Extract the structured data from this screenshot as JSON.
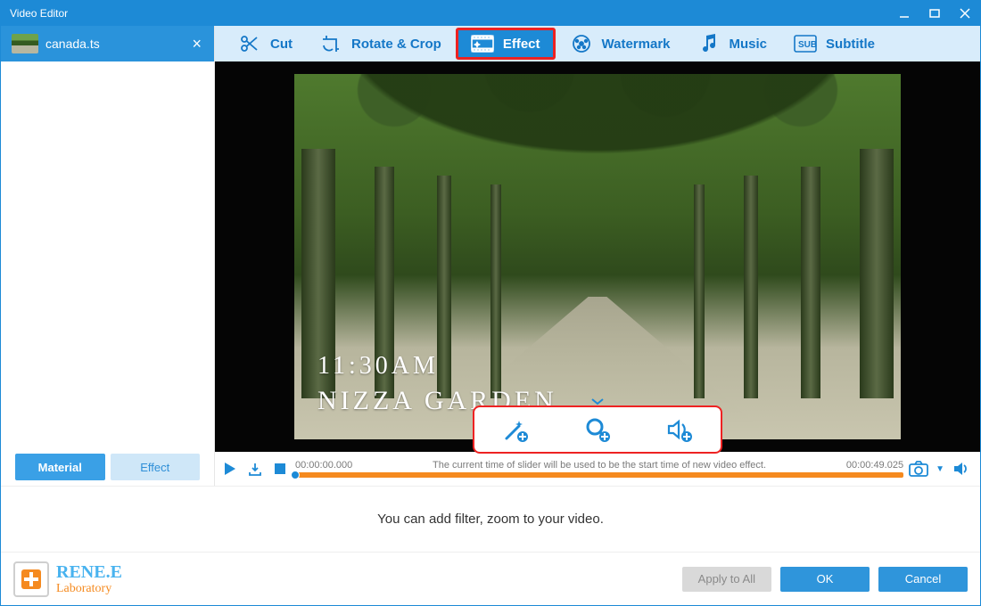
{
  "window": {
    "title": "Video Editor"
  },
  "file": {
    "name": "canada.ts"
  },
  "left_tabs": {
    "material": "Material",
    "effect": "Effect",
    "active": "material"
  },
  "toolbar": {
    "items": [
      {
        "id": "cut",
        "label": "Cut"
      },
      {
        "id": "rotate",
        "label": "Rotate & Crop"
      },
      {
        "id": "effect",
        "label": "Effect"
      },
      {
        "id": "watermark",
        "label": "Watermark"
      },
      {
        "id": "music",
        "label": "Music"
      },
      {
        "id": "subtitle",
        "label": "Subtitle"
      }
    ],
    "active": "effect"
  },
  "preview": {
    "overlay_time": "11:30AM",
    "overlay_place": "NIZZA GARDEN"
  },
  "timeline": {
    "start": "00:00:00.000",
    "end": "00:00:49.025",
    "hint": "The current time of slider will be used to be the start time of new video effect."
  },
  "hint": "You can add filter, zoom to your video.",
  "brand": {
    "line1": "RENE.E",
    "line2": "Laboratory"
  },
  "footer": {
    "apply": "Apply to All",
    "ok": "OK",
    "cancel": "Cancel"
  },
  "pill": {
    "tools": [
      {
        "id": "filter",
        "name": "magic-wand-plus-icon"
      },
      {
        "id": "zoom",
        "name": "magnifier-plus-icon"
      },
      {
        "id": "volume",
        "name": "speaker-plus-icon"
      }
    ]
  }
}
